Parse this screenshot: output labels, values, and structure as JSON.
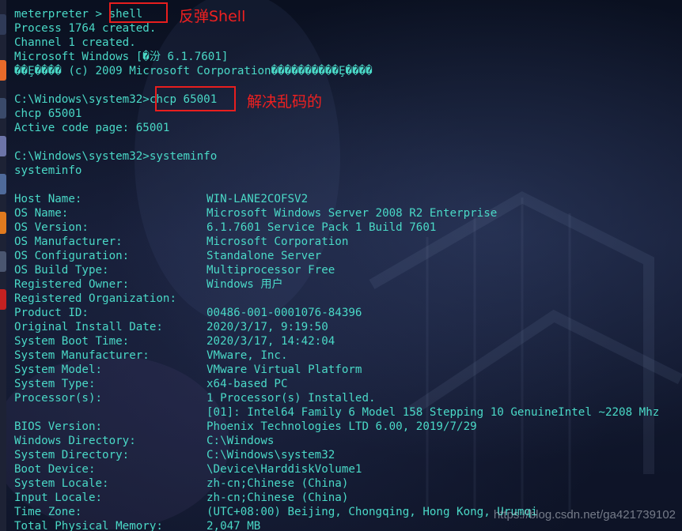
{
  "terminal": {
    "lines": [
      "meterpreter > shell",
      "Process 1764 created.",
      "Channel 1 created.",
      "Microsoft Windows [�汾 6.1.7601]",
      "��Ȩ���� (c) 2009 Microsoft Corporation����������Ȩ����",
      "",
      "C:\\Windows\\system32>chcp 65001",
      "chcp 65001",
      "Active code page: 65001",
      "",
      "C:\\Windows\\system32>systeminfo",
      "systeminfo",
      "",
      "Host Name:"
    ],
    "sysinfo": [
      {
        "label": "Host Name:",
        "value": "WIN-LANE2COFSV2"
      },
      {
        "label": "OS Name:",
        "value": "Microsoft Windows Server 2008 R2 Enterprise"
      },
      {
        "label": "OS Version:",
        "value": "6.1.7601 Service Pack 1 Build 7601"
      },
      {
        "label": "OS Manufacturer:",
        "value": "Microsoft Corporation"
      },
      {
        "label": "OS Configuration:",
        "value": "Standalone Server"
      },
      {
        "label": "OS Build Type:",
        "value": "Multiprocessor Free"
      },
      {
        "label": "Registered Owner:",
        "value": "Windows 用户"
      },
      {
        "label": "Registered Organization:",
        "value": ""
      },
      {
        "label": "Product ID:",
        "value": "00486-001-0001076-84396"
      },
      {
        "label": "Original Install Date:",
        "value": "2020/3/17, 9:19:50"
      },
      {
        "label": "System Boot Time:",
        "value": "2020/3/17, 14:42:04"
      },
      {
        "label": "System Manufacturer:",
        "value": "VMware, Inc."
      },
      {
        "label": "System Model:",
        "value": "VMware Virtual Platform"
      },
      {
        "label": "System Type:",
        "value": "x64-based PC"
      },
      {
        "label": "Processor(s):",
        "value": "1 Processor(s) Installed."
      },
      {
        "label": "",
        "value": "[01]: Intel64 Family 6 Model 158 Stepping 10 GenuineIntel ~2208 Mhz"
      },
      {
        "label": "BIOS Version:",
        "value": "Phoenix Technologies LTD 6.00, 2019/7/29"
      },
      {
        "label": "Windows Directory:",
        "value": "C:\\Windows"
      },
      {
        "label": "System Directory:",
        "value": "C:\\Windows\\system32"
      },
      {
        "label": "Boot Device:",
        "value": "\\Device\\HarddiskVolume1"
      },
      {
        "label": "System Locale:",
        "value": "zh-cn;Chinese (China)"
      },
      {
        "label": "Input Locale:",
        "value": "zh-cn;Chinese (China)"
      },
      {
        "label": "Time Zone:",
        "value": "(UTC+08:00) Beijing, Chongqing, Hong Kong, Urumqi"
      },
      {
        "label": "Total Physical Memory:",
        "value": "2,047 MB"
      }
    ]
  },
  "annotations": {
    "shell": "反弹Shell",
    "chcp": "解决乱码的"
  },
  "watermark": "https://blog.csdn.net/ga421739102",
  "colors": {
    "terminal_text": "#4ad9c7",
    "highlight": "#e81e1e",
    "background": "#0b1120"
  }
}
